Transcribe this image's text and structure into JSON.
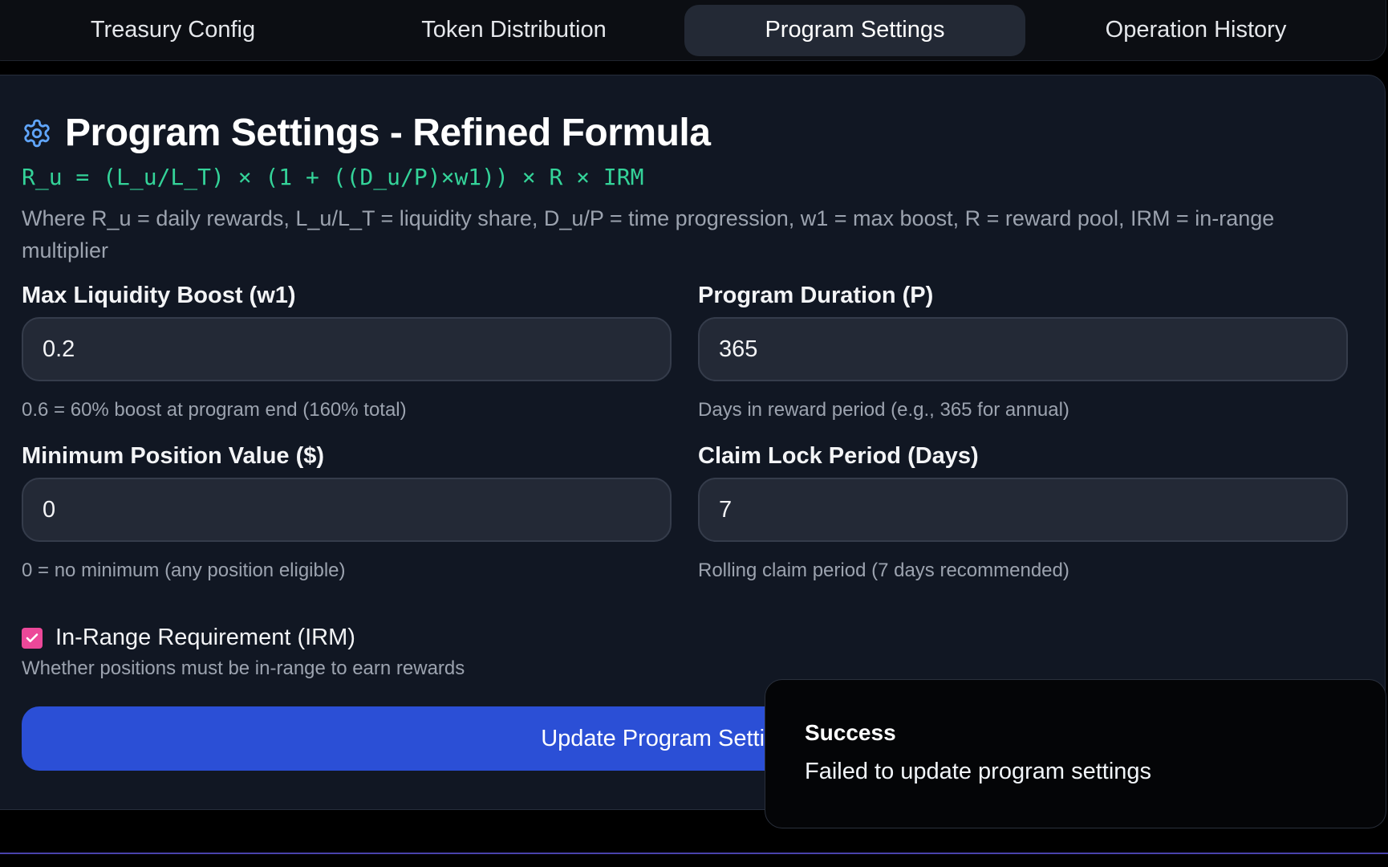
{
  "tabs": [
    {
      "label": "Treasury Config",
      "active": false
    },
    {
      "label": "Token Distribution",
      "active": false
    },
    {
      "label": "Program Settings",
      "active": true
    },
    {
      "label": "Operation History",
      "active": false
    }
  ],
  "settings": {
    "title": "Program Settings - Refined Formula",
    "icon": "gear-icon",
    "formula": "R_u = (L_u/L_T) × (1 + ((D_u/P)×w1)) × R × IRM",
    "description": "Where R_u = daily rewards, L_u/L_T = liquidity share, D_u/P = time progression, w1 = max boost, R = reward pool, IRM = in-range multiplier",
    "fields": {
      "max_boost": {
        "label": "Max Liquidity Boost (w1)",
        "value": "0.2",
        "hint": "0.6 = 60% boost at program end (160% total)"
      },
      "duration": {
        "label": "Program Duration (P)",
        "value": "365",
        "hint": "Days in reward period (e.g., 365 for annual)"
      },
      "min_position": {
        "label": "Minimum Position Value ($)",
        "value": "0",
        "hint": "0 = no minimum (any position eligible)"
      },
      "claim_lock": {
        "label": "Claim Lock Period (Days)",
        "value": "7",
        "hint": "Rolling claim period (7 days recommended)"
      }
    },
    "irm": {
      "label": "In-Range Requirement (IRM)",
      "checked": true,
      "hint": "Whether positions must be in-range to earn rewards"
    },
    "update_button": "Update Program Settings"
  },
  "toast": {
    "title": "Success",
    "message": "Failed to update program settings"
  },
  "colors": {
    "accent": "#2b4fd6",
    "formula": "#34d399",
    "checkbox": "#ec4899"
  }
}
